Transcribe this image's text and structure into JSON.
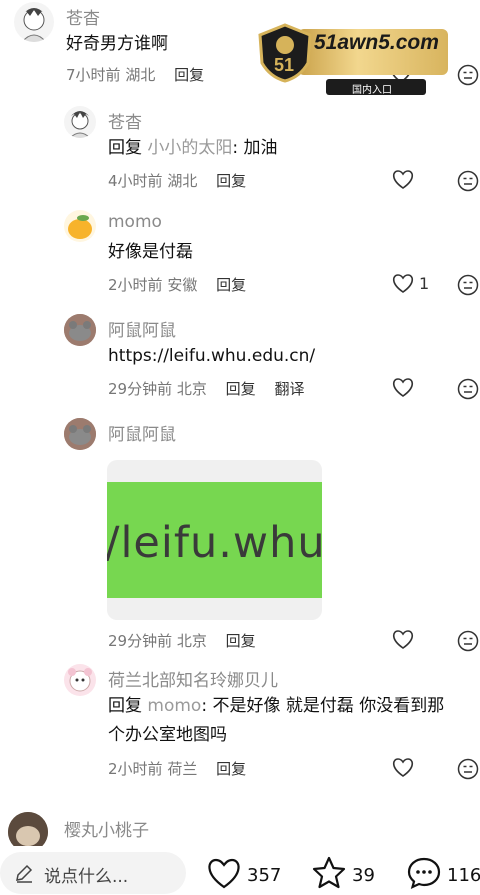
{
  "comments": [
    {
      "name": "苍杳",
      "text": "好奇男方谁啊",
      "time": "7小时前",
      "location": "湖北",
      "reply": "回复"
    },
    {
      "name": "苍杳",
      "reply_prefix": "回复",
      "reply_to": "小小的太阳",
      "text": ": 加油",
      "time": "4小时前",
      "location": "湖北",
      "reply": "回复"
    },
    {
      "name": "momo",
      "text": "好像是付磊",
      "time": "2小时前",
      "location": "安徽",
      "reply": "回复",
      "likes": "1"
    },
    {
      "name": "阿鼠阿鼠",
      "text": "https://leifu.whu.edu.cn/",
      "time": "29分钟前",
      "location": "北京",
      "reply": "回复",
      "translate": "翻译"
    },
    {
      "name": "阿鼠阿鼠",
      "image_text": "/leifu.whu",
      "time": "29分钟前",
      "location": "北京",
      "reply": "回复"
    },
    {
      "name": "荷兰北部知名玲娜贝儿",
      "reply_prefix": "回复",
      "reply_to": "momo",
      "text_line1": ": 不是好像 就是付磊 你没看到那",
      "text_line2": "个办公室地图吗",
      "time": "2小时前",
      "location": "荷兰",
      "reply": "回复"
    },
    {
      "name": "樱丸小桃子"
    }
  ],
  "ad": {
    "domain": "51awn5.com",
    "entry": "国内入口",
    "badge": "51"
  },
  "bottom": {
    "placeholder": "说点什么...",
    "likes": "357",
    "favorites": "39",
    "comments": "116"
  },
  "icons": {
    "like": "heart-outline-icon",
    "dislike": "meh-face-icon",
    "edit": "pencil-icon",
    "star": "star-outline-icon",
    "comment": "chat-bubble-icon"
  }
}
